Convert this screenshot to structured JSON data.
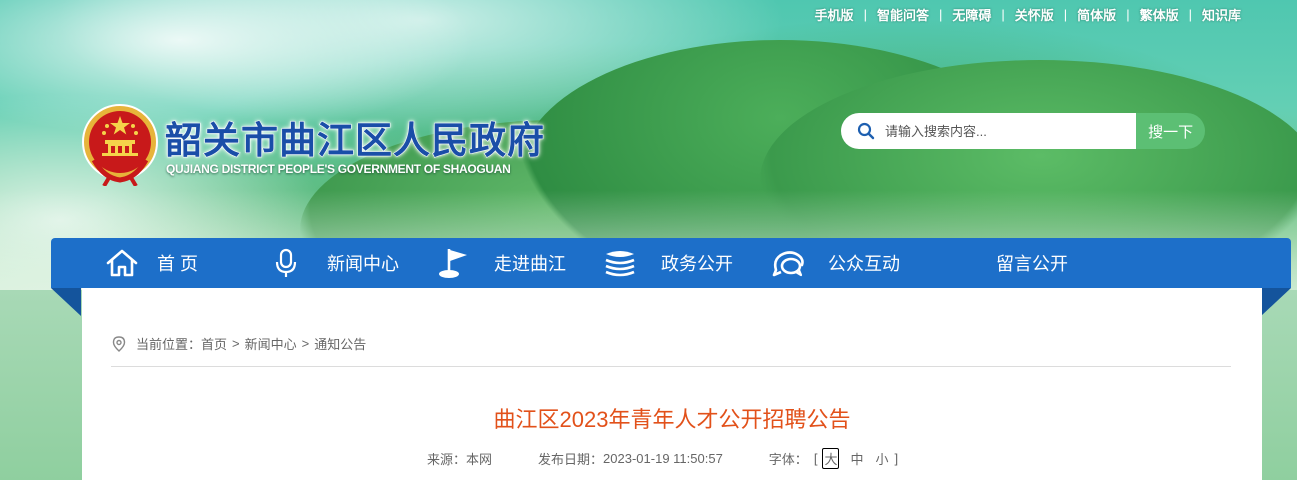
{
  "top_links": [
    "手机版",
    "智能问答",
    "无障碍",
    "关怀版",
    "简体版",
    "繁体版",
    "知识库"
  ],
  "header": {
    "title": "韶关市曲江区人民政府",
    "subtitle": "QUJIANG DISTRICT PEOPLE'S GOVERNMENT OF SHAOGUAN"
  },
  "search": {
    "placeholder": "请输入搜索内容...",
    "button_label": "搜一下"
  },
  "nav": {
    "items": [
      {
        "label": "首 页",
        "icon": "home-icon"
      },
      {
        "label": "新闻中心",
        "icon": "microphone-icon"
      },
      {
        "label": "走进曲江",
        "icon": "flag-icon"
      },
      {
        "label": "政务公开",
        "icon": "layers-icon"
      },
      {
        "label": "公众互动",
        "icon": "chat-bubbles-icon"
      },
      {
        "label": "留言公开",
        "icon": ""
      }
    ]
  },
  "breadcrumb": {
    "prefix": "当前位置：",
    "items": [
      "首页",
      "新闻中心",
      "通知公告"
    ],
    "separator": ">"
  },
  "article": {
    "title": "曲江区2023年青年人才公开招聘公告",
    "source_label": "来源：",
    "source": "本网",
    "date_label": "发布日期：",
    "date": "2023-01-19 11:50:57",
    "font_label": "字体：",
    "font_open": "[",
    "font_close": "]",
    "font_sizes": [
      "大",
      "中",
      "小"
    ],
    "font_selected": "大"
  },
  "colors": {
    "nav_bg": "#1d6fc9",
    "title_accent": "#e2511a",
    "search_button": "#5cbf74",
    "site_title": "#1a4ea8"
  }
}
